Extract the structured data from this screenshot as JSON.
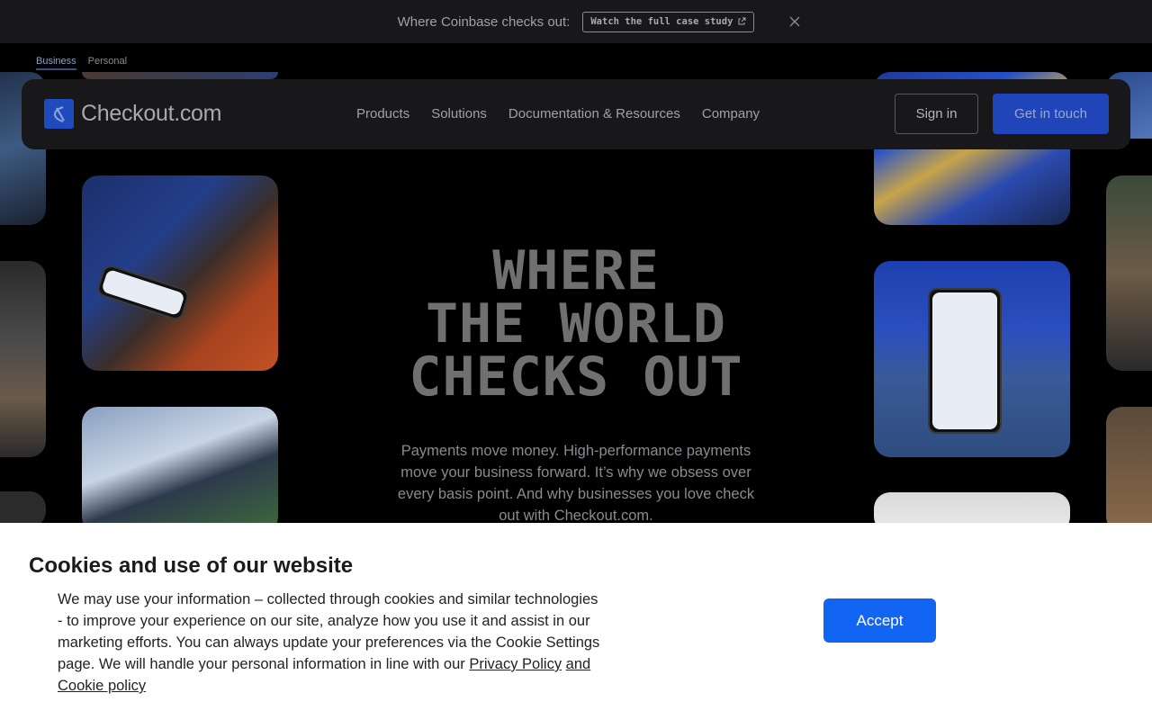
{
  "banner": {
    "text": "Where Coinbase checks out:",
    "cta_label": "Watch the full case study",
    "icons": {
      "cta": "external-link-icon",
      "close": "close-icon"
    }
  },
  "audience_switch": {
    "items": [
      "Business",
      "Personal"
    ],
    "active": "Business"
  },
  "header": {
    "logo_text": "Checkout.com",
    "nav": [
      "Products",
      "Solutions",
      "Documentation & Resources",
      "Company"
    ],
    "sign_in_label": "Sign in",
    "get_in_touch_label": "Get in touch"
  },
  "hero": {
    "title_lines": [
      "WHERE",
      "THE WORLD",
      "CHECKS OUT"
    ],
    "subtitle": "Payments move money. High-performance payments move your business forward. It’s why we obsess over every basis point. And why businesses you love check out with Checkout.com."
  },
  "cookie": {
    "title": "Cookies and use of our website",
    "body": "We may use your information – collected through cookies and similar technologies - to improve your experience on our site, analyze how you use it and assist in our marketing efforts. You can always update your preferences via the Cookie Settings page. We will handle your personal information in line with our",
    "privacy_link": "Privacy Policy",
    "cookie_link": "and Cookie policy",
    "accept_label": "Accept"
  },
  "colors": {
    "brand": "#1f45b8",
    "accept": "#1265f3",
    "background": "#000000"
  }
}
